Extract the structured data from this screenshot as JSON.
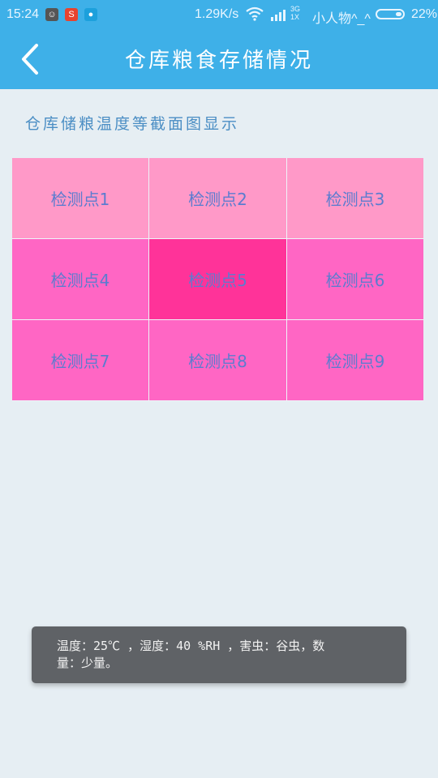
{
  "status_bar": {
    "time": "15:24",
    "net_speed": "1.29K/s",
    "network_type_top": "3G",
    "network_type_bottom": "1X",
    "carrier": "小人物^_^",
    "battery_percent": "22%",
    "battery_level": 0.22,
    "app_icons": [
      {
        "name": "cat-app-icon",
        "glyph": "☺",
        "color": "#555555"
      },
      {
        "name": "red-s-app-icon",
        "glyph": "S",
        "color": "#e8432e"
      },
      {
        "name": "drop-app-icon",
        "glyph": "●",
        "color": "#1ca0dc"
      }
    ]
  },
  "toolbar": {
    "title": "仓库粮食存储情况",
    "background_color": "#3eb0e8"
  },
  "section": {
    "heading": "仓库储粮温度等截面图显示"
  },
  "grid": {
    "cells": [
      {
        "label": "检测点1",
        "color": "#ff99c8"
      },
      {
        "label": "检测点2",
        "color": "#ff99c8"
      },
      {
        "label": "检测点3",
        "color": "#ff99c8"
      },
      {
        "label": "检测点4",
        "color": "#ff66c4"
      },
      {
        "label": "检测点5",
        "color": "#ff3399"
      },
      {
        "label": "检测点6",
        "color": "#ff66c4"
      },
      {
        "label": "检测点7",
        "color": "#ff66c4"
      },
      {
        "label": "检测点8",
        "color": "#ff66c4"
      },
      {
        "label": "检测点9",
        "color": "#ff66c4"
      }
    ]
  },
  "toast": {
    "line1": "温度：25℃ ，湿度：40 %RH ，害虫：谷虫，数",
    "line2": "量：少量。"
  }
}
